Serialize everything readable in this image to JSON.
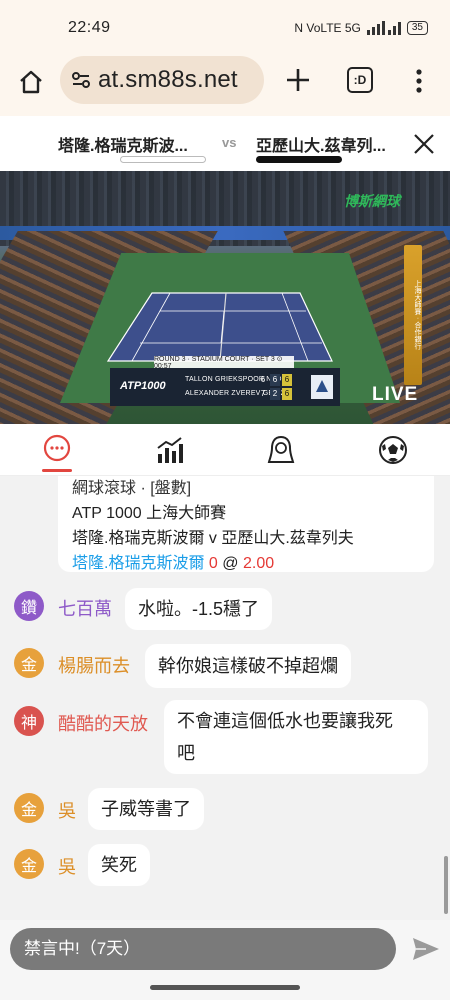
{
  "status_bar": {
    "time": "22:49",
    "indicators": "N VoLTE 5G",
    "battery": "35"
  },
  "browser": {
    "url": "at.sm88s.net",
    "tabs_badge": ":D"
  },
  "match": {
    "home_team": "塔隆.格瑞克斯波...",
    "vs": "vs",
    "away_team": "亞歷山大.茲韋列..."
  },
  "video": {
    "channel_logo": "博斯網球",
    "round_label": "ROUND 3 · STADIUM COURT · SET 3 ⊙ 00:57",
    "atp_logo": "ATP1000",
    "player1": "TALLON GRIEKSPOOR NED",
    "player2": "ALEXANDER ZVEREV GER 2",
    "p1_sets": [
      "6",
      "6",
      "6"
    ],
    "p2_sets": [
      "7",
      "2",
      "6"
    ],
    "live": "LIVE",
    "side_banner": "上海大師賽 · 合作銀行"
  },
  "tabs": [
    {
      "name": "chat",
      "icon": "chat-bubble-icon",
      "active": true
    },
    {
      "name": "stats",
      "icon": "bar-chart-icon",
      "active": false
    },
    {
      "name": "avatar",
      "icon": "person-icon",
      "active": false
    },
    {
      "name": "soccer",
      "icon": "soccer-ball-icon",
      "active": false
    }
  ],
  "card": {
    "line0": "網球滾球 · [盤數]",
    "line1": "ATP 1000 上海大師賽",
    "line2": "塔隆.格瑞克斯波爾 v 亞歷山大.茲韋列夫",
    "bet_team": "塔隆.格瑞克斯波爾",
    "bet_value": "0",
    "bet_at": "@",
    "bet_odds": "2.00"
  },
  "messages": [
    {
      "badge": "鑽",
      "user": "七百萬",
      "text": "水啦。-1.5穩了"
    },
    {
      "badge": "金",
      "user": "楊腸而去",
      "text": "幹你娘這樣破不掉超爛"
    },
    {
      "badge": "神",
      "user": "酷酷的天放",
      "text_line1": "不會連這個低水也要讓我死",
      "text_line2": "吧"
    },
    {
      "badge": "金",
      "user": "吳",
      "text": "子威等書了"
    },
    {
      "badge": "金",
      "user": "吳",
      "text": "笑死"
    }
  ],
  "input": {
    "placeholder": "禁言中!（7天）"
  },
  "colors": {
    "accent_red": "#e2463f",
    "link_blue": "#1c9ee8",
    "badge_purple": "#8e5ac8",
    "badge_gold": "#e7a13c",
    "badge_red": "#d9534f"
  }
}
